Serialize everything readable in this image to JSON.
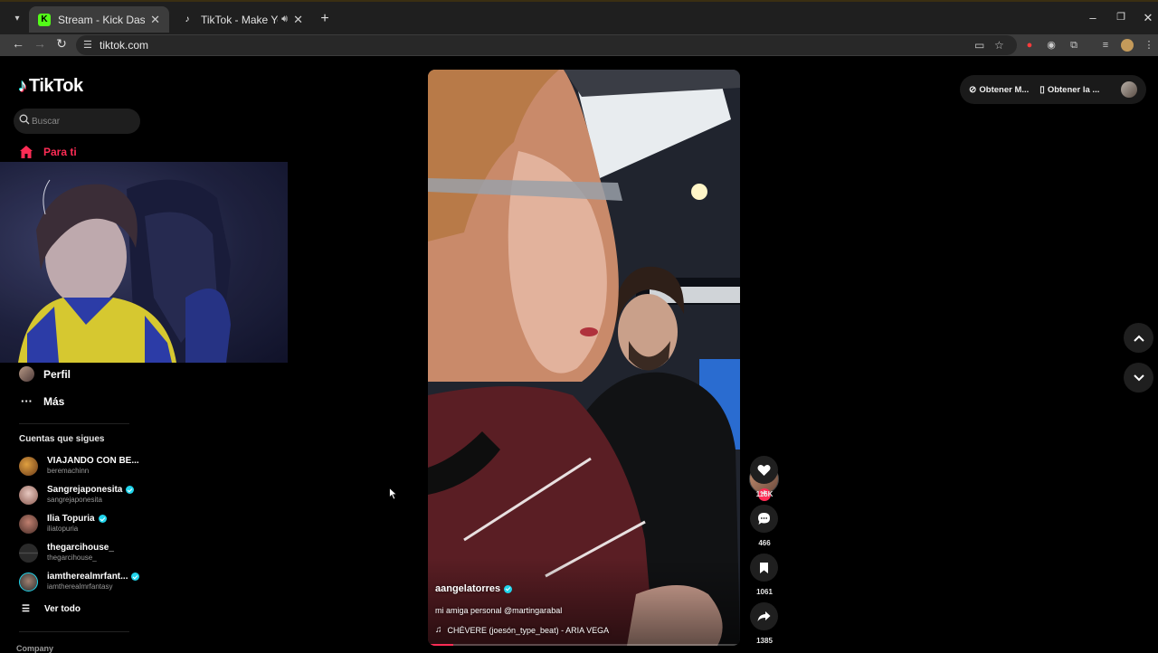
{
  "browser": {
    "tabs": [
      {
        "title": "Stream - Kick Dashboard",
        "favicon": "K",
        "active": true
      },
      {
        "title": "TikTok - Make Your Day",
        "favicon": "tiktok-icon",
        "active": false,
        "audio": true
      }
    ],
    "url": "tiktok.com"
  },
  "tiktok": {
    "logo_text": "TikTok",
    "search_placeholder": "Buscar",
    "nav": {
      "for_you": "Para ti",
      "profile": "Perfil",
      "more": "Más"
    },
    "following": {
      "title": "Cuentas que sigues",
      "accounts": [
        {
          "name": "VIAJANDO CON BE...",
          "handle": "beremachinn",
          "verified": false
        },
        {
          "name": "Sangrejaponesita",
          "handle": "sangrejaponesita",
          "verified": true
        },
        {
          "name": "Ilia Topuria",
          "handle": "iliatopuria",
          "verified": true
        },
        {
          "name": "thegarcihouse_",
          "handle": "thegarcihouse_",
          "verified": false
        },
        {
          "name": "iamtherealmrfant...",
          "handle": "iamtherealmrfantasy",
          "verified": true
        }
      ],
      "see_all": "Ver todo"
    },
    "footer_heading": "Company",
    "top_right": {
      "coins": "Obtener M...",
      "app": "Obtener la ..."
    },
    "video": {
      "username": "aangelatorres",
      "verified": true,
      "description": "mi amiga personal @martingarabal",
      "music": "CHÉVERE (joesón_type_beat) - ARIA VEGA",
      "progress_percent": 8
    },
    "actions": {
      "likes": "115K",
      "comments": "466",
      "saves": "1061",
      "shares": "1385"
    }
  },
  "colors": {
    "accent": "#fe2c55",
    "verified": "#20d5ec",
    "kick_green": "#53fc18"
  }
}
